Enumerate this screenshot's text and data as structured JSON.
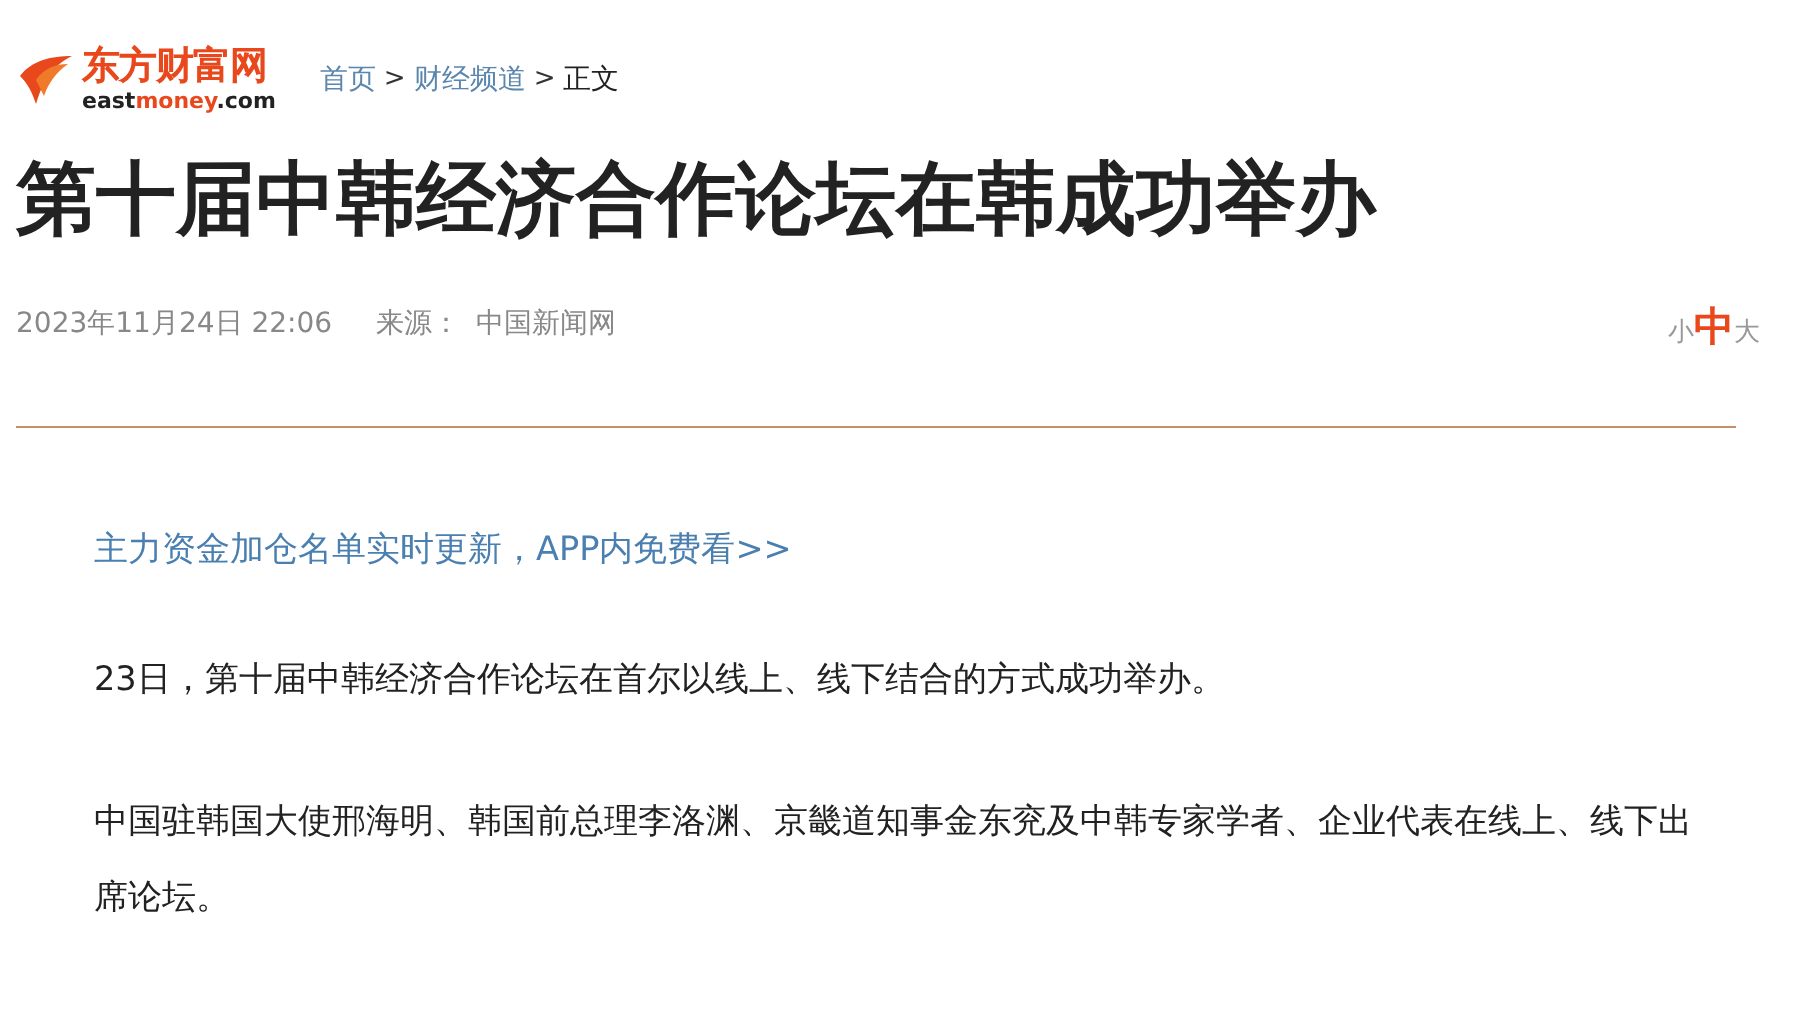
{
  "logo": {
    "name": "东方财富网",
    "domain": [
      {
        "text": "east",
        "highlight": false
      },
      {
        "text": "money",
        "highlight": true
      },
      {
        "text": ".com",
        "highlight": false
      }
    ]
  },
  "breadcrumb": [
    {
      "text": "首页",
      "kind": "link"
    },
    {
      "text": ">",
      "kind": "separator"
    },
    {
      "text": "财经频道",
      "kind": "link"
    },
    {
      "text": ">",
      "kind": "separator"
    },
    {
      "text": "正文",
      "kind": "current"
    }
  ],
  "article": {
    "title": "第十届中韩经济合作论坛在韩成功举办",
    "date": "2023年11月24日 22:06",
    "source_label": "来源：",
    "source": "中国新闻网",
    "font_sizes": [
      {
        "label": "小",
        "selected": false
      },
      {
        "label": "中",
        "selected": true
      },
      {
        "label": "大",
        "selected": false
      }
    ],
    "promo_link": "主力资金加仓名单实时更新，APP内免费看>>",
    "paragraphs": [
      "23日，第十届中韩经济合作论坛在首尔以线上、线下结合的方式成功举办。",
      "中国驻韩国大使邢海明、韩国前总理李洛渊、京畿道知事金东兖及中韩专家学者、企业代表在线上、线下出席论坛。"
    ]
  }
}
